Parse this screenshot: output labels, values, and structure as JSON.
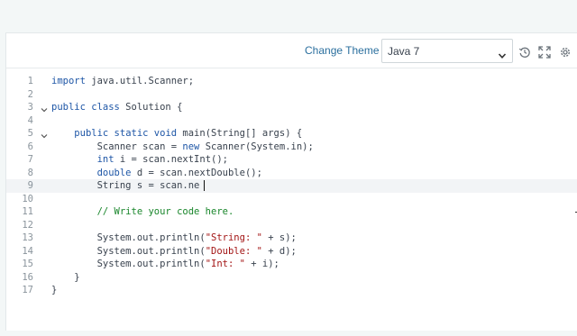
{
  "toolbar": {
    "change_theme_label": "Change Theme",
    "language_value": "Java 7",
    "icons": [
      "history-icon",
      "fullscreen-icon",
      "settings-icon"
    ]
  },
  "editor": {
    "active_line": 9,
    "lines": [
      {
        "n": "1",
        "fold": false,
        "tokens": [
          {
            "t": "import",
            "c": "kw"
          },
          {
            "t": " java.util.Scanner;",
            "c": "pl"
          }
        ]
      },
      {
        "n": "2",
        "fold": false,
        "tokens": []
      },
      {
        "n": "3",
        "fold": true,
        "tokens": [
          {
            "t": "public class",
            "c": "kw"
          },
          {
            "t": " Solution {",
            "c": "pl"
          }
        ]
      },
      {
        "n": "4",
        "fold": false,
        "tokens": []
      },
      {
        "n": "5",
        "fold": true,
        "tokens": [
          {
            "t": "    ",
            "c": "pl"
          },
          {
            "t": "public static void",
            "c": "kw"
          },
          {
            "t": " main(String[] args) {",
            "c": "pl"
          }
        ]
      },
      {
        "n": "6",
        "fold": false,
        "tokens": [
          {
            "t": "        Scanner scan = ",
            "c": "pl"
          },
          {
            "t": "new",
            "c": "kw"
          },
          {
            "t": " Scanner(System.in);",
            "c": "pl"
          }
        ]
      },
      {
        "n": "7",
        "fold": false,
        "tokens": [
          {
            "t": "        ",
            "c": "pl"
          },
          {
            "t": "int",
            "c": "kw"
          },
          {
            "t": " i = scan.nextInt();",
            "c": "pl"
          }
        ]
      },
      {
        "n": "8",
        "fold": false,
        "tokens": [
          {
            "t": "        ",
            "c": "pl"
          },
          {
            "t": "double",
            "c": "kw"
          },
          {
            "t": " d = scan.nextDouble();",
            "c": "pl"
          }
        ]
      },
      {
        "n": "9",
        "fold": false,
        "tokens": [
          {
            "t": "        String s = scan.ne",
            "c": "pl"
          }
        ]
      },
      {
        "n": "10",
        "fold": false,
        "tokens": []
      },
      {
        "n": "11",
        "fold": false,
        "tokens": [
          {
            "t": "        // Write your code here.",
            "c": "cm"
          }
        ]
      },
      {
        "n": "12",
        "fold": false,
        "tokens": []
      },
      {
        "n": "13",
        "fold": false,
        "tokens": [
          {
            "t": "        System.out.println(",
            "c": "pl"
          },
          {
            "t": "\"String: \"",
            "c": "str"
          },
          {
            "t": " + s);",
            "c": "pl"
          }
        ]
      },
      {
        "n": "14",
        "fold": false,
        "tokens": [
          {
            "t": "        System.out.println(",
            "c": "pl"
          },
          {
            "t": "\"Double: \"",
            "c": "str"
          },
          {
            "t": " + d);",
            "c": "pl"
          }
        ]
      },
      {
        "n": "15",
        "fold": false,
        "tokens": [
          {
            "t": "        System.out.println(",
            "c": "pl"
          },
          {
            "t": "\"Int: \"",
            "c": "str"
          },
          {
            "t": " + i);",
            "c": "pl"
          }
        ]
      },
      {
        "n": "16",
        "fold": false,
        "tokens": [
          {
            "t": "    }",
            "c": "pl"
          }
        ]
      },
      {
        "n": "17",
        "fold": false,
        "tokens": [
          {
            "t": "}",
            "c": "pl"
          }
        ]
      }
    ]
  },
  "colors": {
    "keyword": "#1e56a6",
    "string": "#a31515",
    "comment": "#19862b",
    "link": "#2b6f9e"
  }
}
